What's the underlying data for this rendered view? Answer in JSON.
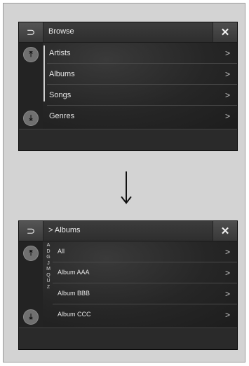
{
  "screen1": {
    "title": "Browse",
    "back_icon": "⊃",
    "close_icon": "✕",
    "scroll_up_icon": "⤒",
    "scroll_down_icon": "⤓",
    "items": [
      {
        "label": "Artists",
        "chevron": ">"
      },
      {
        "label": "Albums",
        "chevron": ">"
      },
      {
        "label": "Songs",
        "chevron": ">"
      },
      {
        "label": "Genres",
        "chevron": ">"
      }
    ]
  },
  "transition_arrow": "⟶",
  "screen2": {
    "title": "> Albums",
    "back_icon": "⊃",
    "close_icon": "✕",
    "scroll_up_icon": "⤒",
    "scroll_down_icon": "⤓",
    "alphabet": [
      "A",
      "D",
      "G",
      "J",
      "M",
      "Q",
      "U",
      "Z"
    ],
    "items": [
      {
        "label": "All",
        "chevron": ">"
      },
      {
        "label": "Album AAA",
        "chevron": ">"
      },
      {
        "label": "Album BBB",
        "chevron": ">"
      },
      {
        "label": "Album CCC",
        "chevron": ">"
      }
    ]
  }
}
